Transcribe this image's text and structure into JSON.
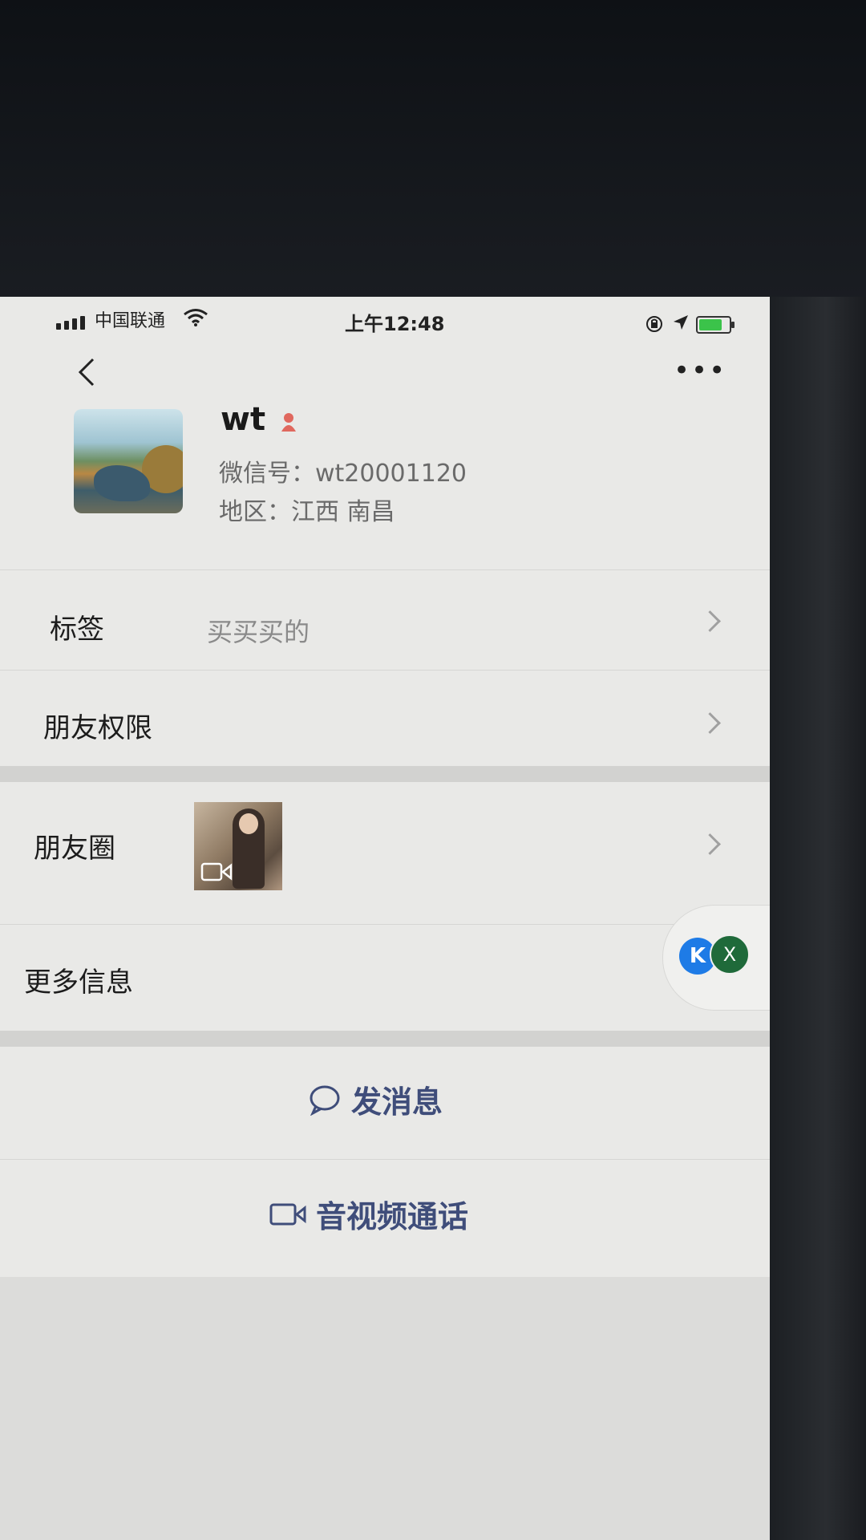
{
  "status_bar": {
    "carrier": "中国联通",
    "time": "上午12:48",
    "icons": [
      "signal-icon",
      "wifi-icon",
      "rotation-lock-icon",
      "location-icon",
      "battery-icon"
    ]
  },
  "nav": {
    "back_icon": "chevron-left-icon",
    "more_icon": "more-dots-icon",
    "more_label": "•••"
  },
  "profile": {
    "name": "wt",
    "gender_icon": "female-icon",
    "wechat_id": "微信号：wt20001120",
    "region": "地区：江西 南昌"
  },
  "rows": {
    "tags": {
      "label": "标签",
      "value": "买买买的"
    },
    "friend_permissions": {
      "label": "朋友权限"
    },
    "moments": {
      "label": "朋友圈"
    },
    "more_info": {
      "label": "更多信息"
    }
  },
  "floating": {
    "blue_letter": "K",
    "green_letter": "X"
  },
  "actions": {
    "send_message": "发消息",
    "video_call": "音视频通话"
  },
  "colors": {
    "accent": "#3f4d7a",
    "background": "#e9e9e7",
    "separator": "#d2d2d0"
  }
}
